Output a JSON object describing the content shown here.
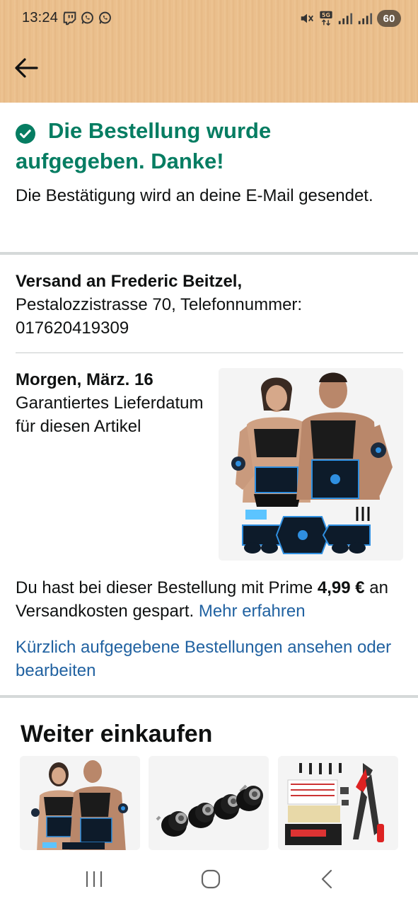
{
  "status_bar": {
    "time": "13:24",
    "battery": "60",
    "network": "5G",
    "left_icons": [
      "twitch-icon",
      "whatsapp-icon",
      "whatsapp-icon"
    ],
    "right_icons": [
      "mute-icon",
      "data-5g-icon",
      "signal-icon",
      "signal-icon",
      "battery-icon"
    ]
  },
  "header": {
    "back_icon": "arrow-left-icon",
    "background_color": "#e9bd8a"
  },
  "confirmation": {
    "icon": "check-circle-icon",
    "title_line1": "Die Bestellung wurde",
    "title_line2": "aufgegeben. Danke!",
    "subtitle": "Die Bestätigung wird an deine E-Mail gesendet.",
    "color": "#067d62"
  },
  "shipping": {
    "name": "Versand an Frederic Beitzel,",
    "address": "Pestalozzistrasse 70, Telefonnummer: 017620419309"
  },
  "delivery": {
    "date": "Morgen, März. 16",
    "note": "Garantiertes Lieferdatum für diesen Artikel",
    "image": "ems-muscle-stimulator-product-image"
  },
  "savings": {
    "text_before": "Du hast bei dieser Bestellung mit Prime ",
    "amount": "4,99 €",
    "text_after": " an Versandkosten gespart. ",
    "link": "Mehr erfahren",
    "link_color": "#2162a1"
  },
  "orders_link": "Kürzlich aufgegebene Bestellungen ansehen oder bearbeiten",
  "continue_shopping": {
    "title": "Weiter einkaufen",
    "items": [
      {
        "image": "ems-muscle-stimulator-image"
      },
      {
        "image": "rubber-mounts-image"
      },
      {
        "image": "rivet-tool-kit-image"
      }
    ]
  },
  "nav_bar": {
    "buttons": [
      "recent-apps-icon",
      "home-icon",
      "back-icon"
    ]
  }
}
